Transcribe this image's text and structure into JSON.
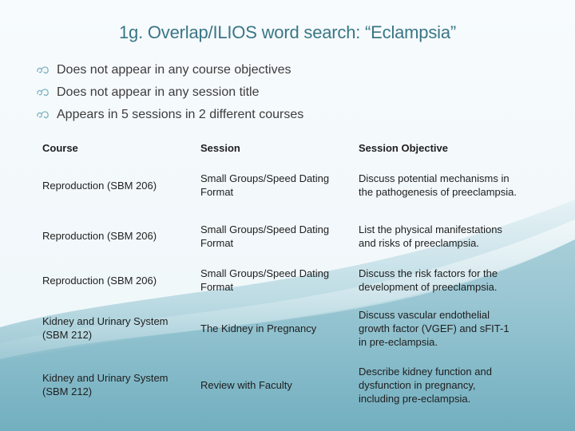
{
  "slide": {
    "title": "1g. Overlap/ILIOS word search: “Eclampsia”",
    "colors": {
      "title": "#3a7686",
      "bullet_icon": "#7fb3bf",
      "text": "#3c3c3c",
      "background_top": "#f6fbfd",
      "wave_bottom": "#6aaabb"
    },
    "bullets": [
      {
        "icon": "curly-bullet-icon",
        "text": "Does not appear in any course objectives"
      },
      {
        "icon": "curly-bullet-icon",
        "text": "Does not appear in any session title"
      },
      {
        "icon": "curly-bullet-icon",
        "text": "Appears in 5 sessions in 2 different courses"
      }
    ],
    "table": {
      "headers": [
        "Course",
        "Session",
        "Session Objective"
      ],
      "rows": [
        {
          "course": "Reproduction (SBM 206)",
          "session": "Small Groups/Speed Dating Format",
          "objective": "Discuss potential mechanisms in the pathogenesis of preeclampsia."
        },
        {
          "course": "Reproduction (SBM 206)",
          "session": "Small Groups/Speed Dating Format",
          "objective": "List the physical manifestations and risks of preeclampsia."
        },
        {
          "course": "Reproduction (SBM 206)",
          "session": "Small Groups/Speed Dating Format",
          "objective": "Discuss the risk factors for the development of preeclampsia."
        },
        {
          "course": "Kidney and Urinary System (SBM 212)",
          "session": "The Kidney in Pregnancy",
          "objective": "Discuss vascular endothelial growth factor (VGEF) and sFIT-1 in pre-eclampsia."
        },
        {
          "course": "Kidney and Urinary System (SBM 212)",
          "session": "Review with Faculty",
          "objective": "Describe kidney function and dysfunction in pregnancy, including pre-eclampsia."
        }
      ]
    }
  }
}
